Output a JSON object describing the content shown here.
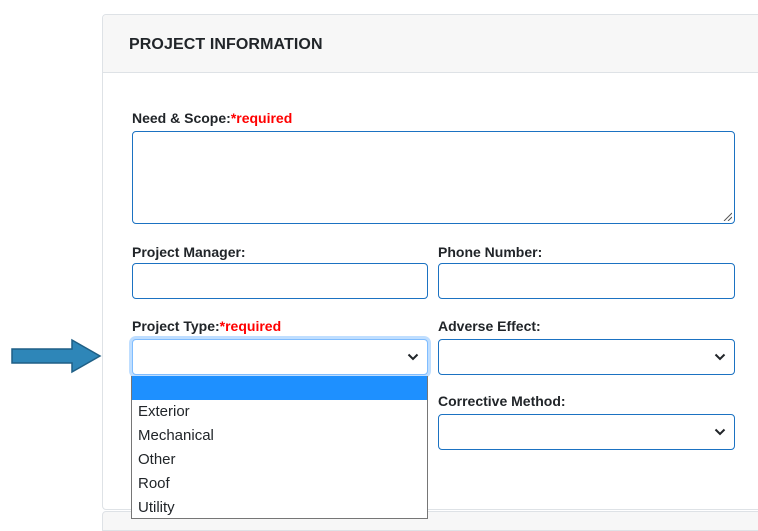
{
  "panel": {
    "title": "PROJECT INFORMATION"
  },
  "fields": {
    "need_scope": {
      "label": "Need & Scope:",
      "required": "*required",
      "value": ""
    },
    "project_manager": {
      "label": "Project Manager:",
      "value": ""
    },
    "phone_number": {
      "label": "Phone Number:",
      "value": ""
    },
    "project_type": {
      "label": "Project Type:",
      "required": "*required",
      "selected": ""
    },
    "adverse_effect": {
      "label": "Adverse Effect:",
      "selected": ""
    },
    "corrective_method": {
      "label": "Corrective Method:",
      "selected": ""
    }
  },
  "project_type_options": [
    "",
    "Exterior",
    "Mechanical",
    "Other",
    "Roof",
    "Utility"
  ],
  "colors": {
    "required_text": "#ff0000",
    "input_border": "#1b72c2",
    "selected_option": "#1e90ff",
    "arrow_fill": "#2e86b8"
  },
  "icons": {
    "pointer": "arrow-right-icon",
    "chevron": "chevron-down-icon",
    "resize": "resize-grip-icon"
  }
}
